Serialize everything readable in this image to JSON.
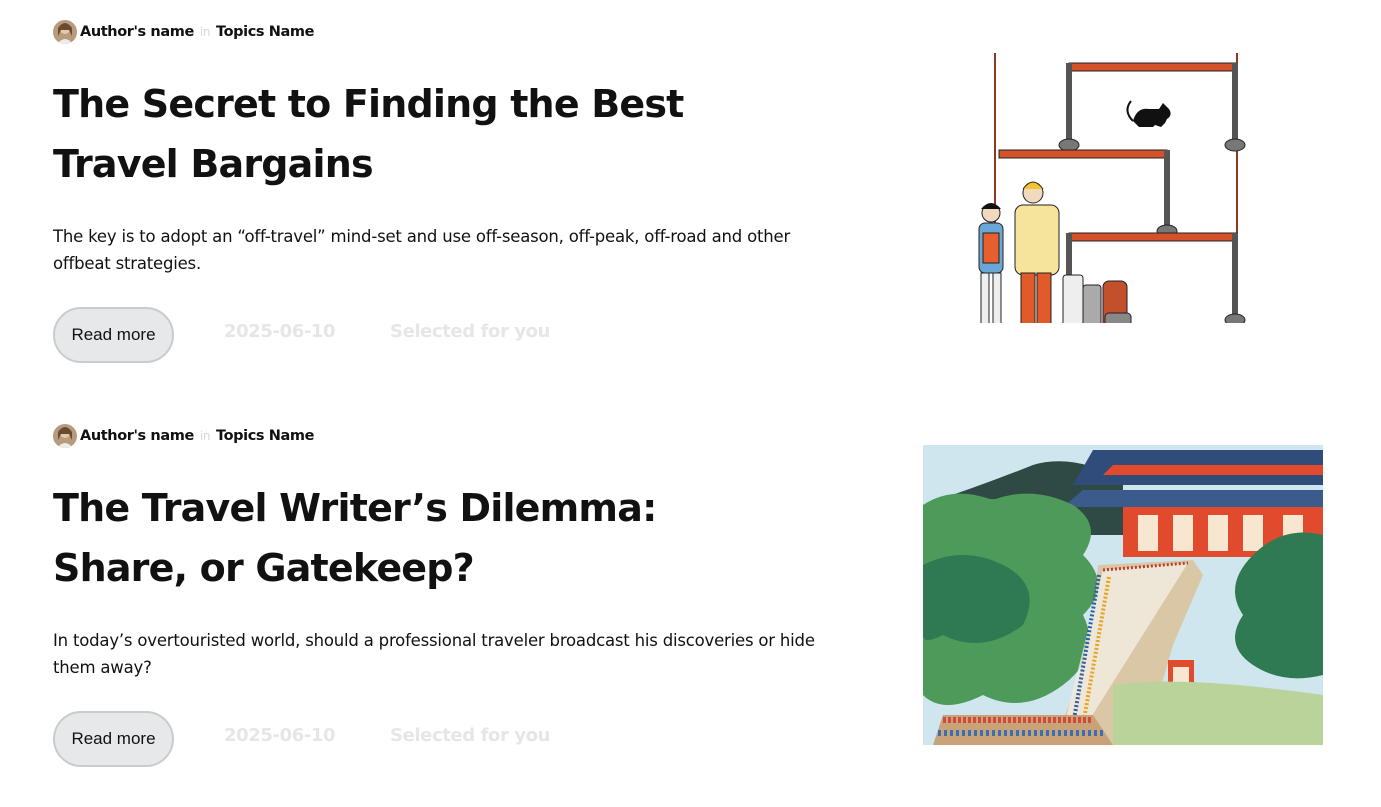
{
  "articles": [
    {
      "author": "Author's name",
      "in": "in",
      "topic": "Topics Name",
      "title": "The Secret to Finding the Best Travel Bargains",
      "summary": "The key is to adopt an “off-travel” mind-set and use off-season, off-peak, off-road and other offbeat strategies.",
      "read_more": "Read more",
      "date": "2025-06-10",
      "tag": "Selected for you",
      "image_icon": "travel-queue-illustration"
    },
    {
      "author": "Author's name",
      "in": "in",
      "topic": "Topics Name",
      "title": "The Travel Writer’s Dilemma: Share, or Gatekeep?",
      "summary": "In today’s overtouristed world, should a professional traveler broadcast his discoveries or hide them away?",
      "read_more": "Read more",
      "date": "2025-06-10",
      "tag": "Selected for you",
      "image_icon": "temple-crowd-illustration"
    }
  ]
}
